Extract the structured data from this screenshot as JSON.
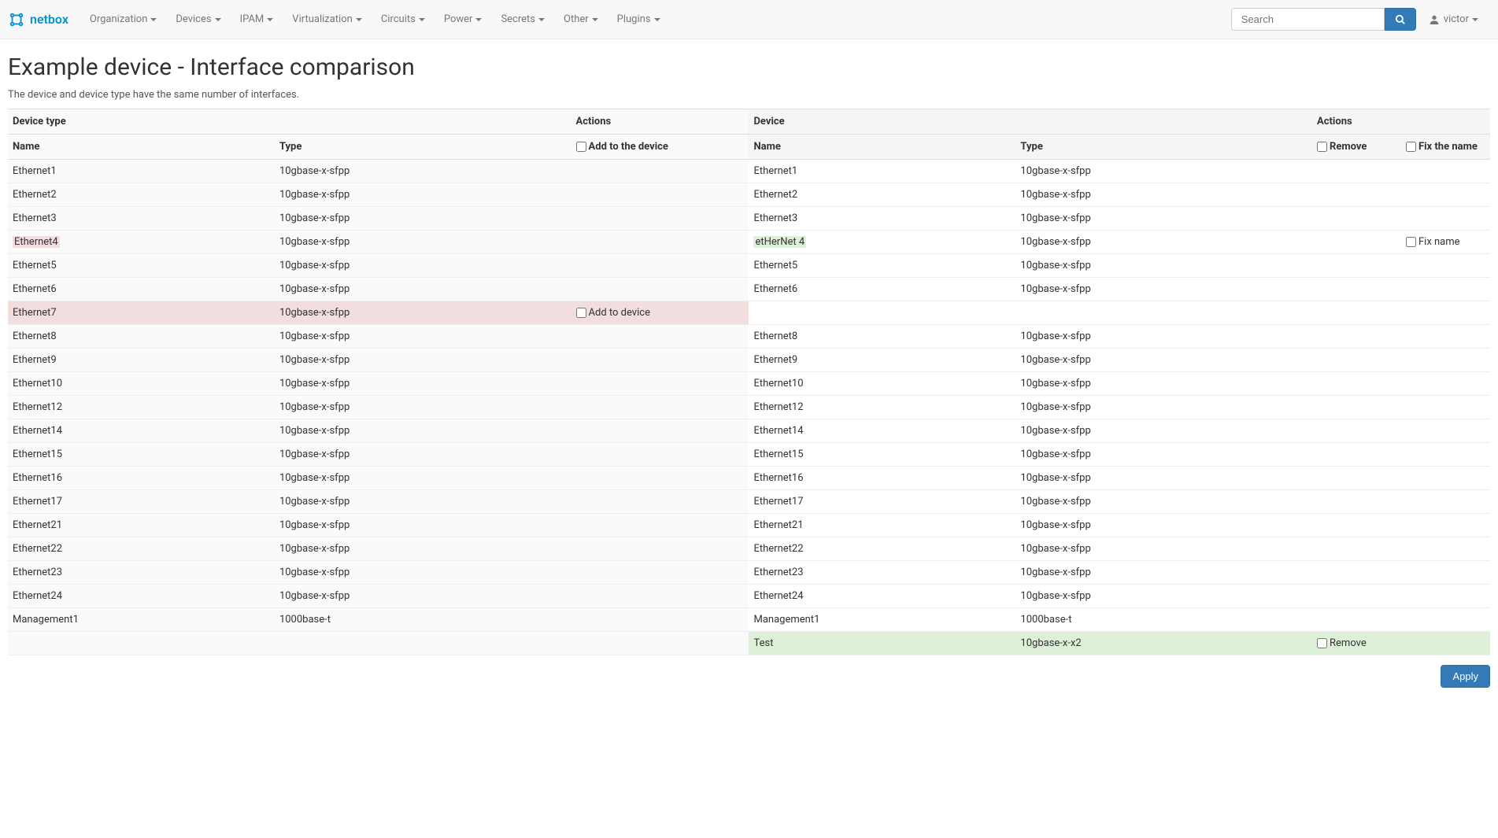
{
  "brand": "netbox",
  "nav": [
    "Organization",
    "Devices",
    "IPAM",
    "Virtualization",
    "Circuits",
    "Power",
    "Secrets",
    "Other",
    "Plugins"
  ],
  "search": {
    "placeholder": "Search"
  },
  "user": "victor",
  "page": {
    "title": "Example device - Interface comparison",
    "subtitle": "The device and device type have the same number of interfaces."
  },
  "headers": {
    "device_type": "Device type",
    "actions": "Actions",
    "device": "Device",
    "name": "Name",
    "type": "Type",
    "add_to_device_header": "Add to the device",
    "remove_header": "Remove",
    "fix_name_header": "Fix the name"
  },
  "labels": {
    "add_to_device": "Add to device",
    "fix_name": "Fix name",
    "remove": "Remove",
    "apply": "Apply"
  },
  "rows": [
    {
      "l_name": "Ethernet1",
      "l_type": "10gbase-x-sfpp",
      "r_name": "Ethernet1",
      "r_type": "10gbase-x-sfpp"
    },
    {
      "l_name": "Ethernet2",
      "l_type": "10gbase-x-sfpp",
      "r_name": "Ethernet2",
      "r_type": "10gbase-x-sfpp"
    },
    {
      "l_name": "Ethernet3",
      "l_type": "10gbase-x-sfpp",
      "r_name": "Ethernet3",
      "r_type": "10gbase-x-sfpp"
    },
    {
      "l_name": "Ethernet4",
      "l_type": "10gbase-x-sfpp",
      "r_name": "etHerNet 4",
      "r_type": "10gbase-x-sfpp",
      "l_hl": "red",
      "r_hl": "green",
      "fix_name": true
    },
    {
      "l_name": "Ethernet5",
      "l_type": "10gbase-x-sfpp",
      "r_name": "Ethernet5",
      "r_type": "10gbase-x-sfpp"
    },
    {
      "l_name": "Ethernet6",
      "l_type": "10gbase-x-sfpp",
      "r_name": "Ethernet6",
      "r_type": "10gbase-x-sfpp"
    },
    {
      "l_name": "Ethernet7",
      "l_type": "10gbase-x-sfpp",
      "left_red_row": true,
      "add_to_device": true
    },
    {
      "l_name": "Ethernet8",
      "l_type": "10gbase-x-sfpp",
      "r_name": "Ethernet8",
      "r_type": "10gbase-x-sfpp"
    },
    {
      "l_name": "Ethernet9",
      "l_type": "10gbase-x-sfpp",
      "r_name": "Ethernet9",
      "r_type": "10gbase-x-sfpp"
    },
    {
      "l_name": "Ethernet10",
      "l_type": "10gbase-x-sfpp",
      "r_name": "Ethernet10",
      "r_type": "10gbase-x-sfpp"
    },
    {
      "l_name": "Ethernet12",
      "l_type": "10gbase-x-sfpp",
      "r_name": "Ethernet12",
      "r_type": "10gbase-x-sfpp"
    },
    {
      "l_name": "Ethernet14",
      "l_type": "10gbase-x-sfpp",
      "r_name": "Ethernet14",
      "r_type": "10gbase-x-sfpp"
    },
    {
      "l_name": "Ethernet15",
      "l_type": "10gbase-x-sfpp",
      "r_name": "Ethernet15",
      "r_type": "10gbase-x-sfpp"
    },
    {
      "l_name": "Ethernet16",
      "l_type": "10gbase-x-sfpp",
      "r_name": "Ethernet16",
      "r_type": "10gbase-x-sfpp"
    },
    {
      "l_name": "Ethernet17",
      "l_type": "10gbase-x-sfpp",
      "r_name": "Ethernet17",
      "r_type": "10gbase-x-sfpp"
    },
    {
      "l_name": "Ethernet21",
      "l_type": "10gbase-x-sfpp",
      "r_name": "Ethernet21",
      "r_type": "10gbase-x-sfpp"
    },
    {
      "l_name": "Ethernet22",
      "l_type": "10gbase-x-sfpp",
      "r_name": "Ethernet22",
      "r_type": "10gbase-x-sfpp"
    },
    {
      "l_name": "Ethernet23",
      "l_type": "10gbase-x-sfpp",
      "r_name": "Ethernet23",
      "r_type": "10gbase-x-sfpp"
    },
    {
      "l_name": "Ethernet24",
      "l_type": "10gbase-x-sfpp",
      "r_name": "Ethernet24",
      "r_type": "10gbase-x-sfpp"
    },
    {
      "l_name": "Management1",
      "l_type": "1000base-t",
      "r_name": "Management1",
      "r_type": "1000base-t"
    },
    {
      "r_name": "Test",
      "r_type": "10gbase-x-x2",
      "right_green_row": true,
      "remove": true
    }
  ]
}
